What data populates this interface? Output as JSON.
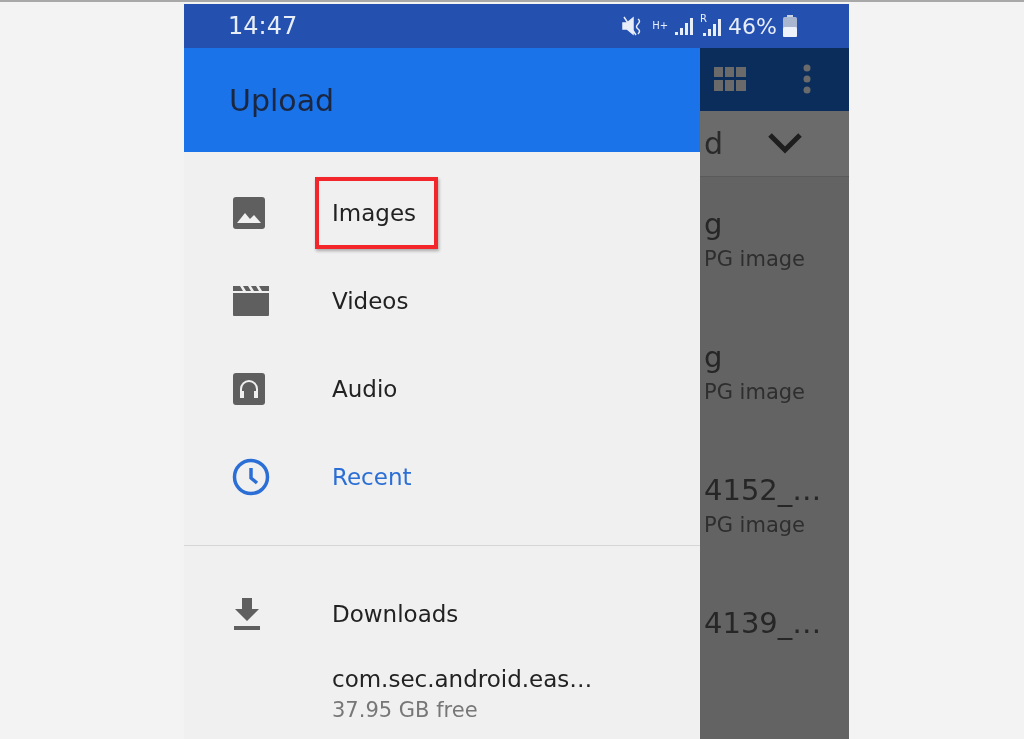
{
  "status_bar": {
    "time": "14:47",
    "network_label": "H+",
    "roaming_label": "R",
    "battery": "46%"
  },
  "drawer": {
    "title": "Upload",
    "items": [
      {
        "label": "Images",
        "kind": "image",
        "selected": false,
        "highlighted": true
      },
      {
        "label": "Videos",
        "kind": "video",
        "selected": false,
        "highlighted": false
      },
      {
        "label": "Audio",
        "kind": "audio",
        "selected": false,
        "highlighted": false
      },
      {
        "label": "Recent",
        "kind": "recent",
        "selected": true,
        "highlighted": false
      }
    ],
    "locations": [
      {
        "label": "Downloads",
        "kind": "folder"
      },
      {
        "label": "com.sec.android.eas…",
        "kind": "storage",
        "subtitle": "37.95 GB free"
      }
    ]
  },
  "background": {
    "header": "d",
    "files": [
      {
        "name": "g",
        "type": "PG image"
      },
      {
        "name": "g",
        "type": "PG image"
      },
      {
        "name": "4152_…",
        "type": "PG image"
      },
      {
        "name": "4139_…"
      }
    ]
  }
}
